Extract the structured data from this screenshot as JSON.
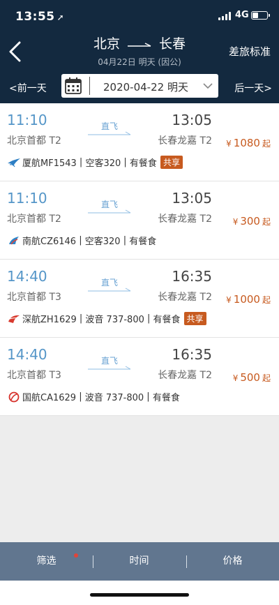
{
  "status": {
    "time": "13:55",
    "network": "4G"
  },
  "header": {
    "from": "北京",
    "to": "长春",
    "subtitle": "04月22日 明天 (因公)",
    "policy_label": "差旅标准",
    "prev_day": "前一天",
    "next_day": "后一天",
    "date_text": "2020-04-22 明天"
  },
  "flights": [
    {
      "dep_time": "11:10",
      "arr_time": "13:05",
      "direct": "直飞",
      "dep_airport": "北京首都 T2",
      "arr_airport": "长春龙嘉 T2",
      "price_symbol": "¥",
      "price": "1080",
      "price_suffix": "起",
      "airline_icon": "xiamen-airlines-logo",
      "flight_no": "厦航MF1543",
      "aircraft": "空客320",
      "meal": "有餐食",
      "shared": "共享"
    },
    {
      "dep_time": "11:10",
      "arr_time": "13:05",
      "direct": "直飞",
      "dep_airport": "北京首都 T2",
      "arr_airport": "长春龙嘉 T2",
      "price_symbol": "¥",
      "price": "300",
      "price_suffix": "起",
      "airline_icon": "china-southern-logo",
      "flight_no": "南航CZ6146",
      "aircraft": "空客320",
      "meal": "有餐食",
      "shared": ""
    },
    {
      "dep_time": "14:40",
      "arr_time": "16:35",
      "direct": "直飞",
      "dep_airport": "北京首都 T3",
      "arr_airport": "长春龙嘉 T2",
      "price_symbol": "¥",
      "price": "1000",
      "price_suffix": "起",
      "airline_icon": "shenzhen-airlines-logo",
      "flight_no": "深航ZH1629",
      "aircraft": "波音 737-800",
      "meal": "有餐食",
      "shared": "共享"
    },
    {
      "dep_time": "14:40",
      "arr_time": "16:35",
      "direct": "直飞",
      "dep_airport": "北京首都 T3",
      "arr_airport": "长春龙嘉 T2",
      "price_symbol": "¥",
      "price": "500",
      "price_suffix": "起",
      "airline_icon": "air-china-logo",
      "flight_no": "国航CA1629",
      "aircraft": "波音 737-800",
      "meal": "有餐食",
      "shared": ""
    }
  ],
  "tabs": {
    "filter": "筛选",
    "time": "时间",
    "price": "价格"
  },
  "colors": {
    "header_bg": "#13293f",
    "accent_blue": "#5596c8",
    "price": "#c75a1f",
    "tabbar_bg": "#61768f"
  }
}
